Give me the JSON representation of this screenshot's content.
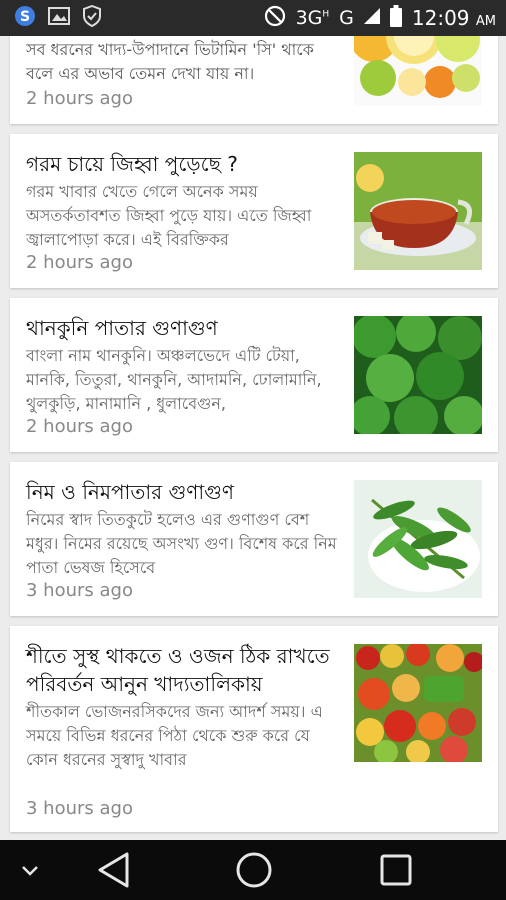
{
  "status_bar": {
    "left_icons": [
      "sync-app-icon",
      "image-icon",
      "shield-check-icon"
    ],
    "network_3g": "3G",
    "network_3g_sup": "H",
    "network_g": "G",
    "time": "12:09",
    "ampm": "AM",
    "right_icons": [
      "do-not-disturb-icon",
      "signal-icon",
      "battery-icon"
    ]
  },
  "articles": [
    {
      "title": "",
      "snippet": "সব ধরনের খাদ্য-উপাদানে ভিটামিন 'সি' থাকে বলে এর অভাব তেমন দেখা যায় না।",
      "time": "2 hours ago",
      "image": "citrus-fruits-thumbnail"
    },
    {
      "title": "গরম চায়ে জিহ্বা পুড়েছে ?",
      "snippet": "গরম খাবার খেতে গেলে অনেক সময় অসতর্কতাবশত জিহ্বা পুড়ে যায়। এতে জিহ্বা জ্বালাপোড়া করে। এই বিরক্তিকর",
      "time": "2 hours ago",
      "image": "tea-cup-thumbnail"
    },
    {
      "title": "থানকুনি পাতার গুণাগুণ",
      "snippet": "বাংলা নাম থানকুনি। অঞ্চলভেদে এটি টেয়া, মানকি, তিতুরা, থানকুনি, আদামনি, ঢোলামানি, থুলকুড়ি, মানামানি , ধুলাবেগুন,",
      "time": "2 hours ago",
      "image": "thankuni-leaves-thumbnail"
    },
    {
      "title": "নিম ও নিমপাতার গুণাগুণ",
      "snippet": "নিমের স্বাদ তিতকুটে হলেও এর গুণাগুণ বেশ মধুর। নিমের রয়েছে অসংখ্য গুণ। বিশেষ করে নিম পাতা ভেষজ হিসেবে",
      "time": "3 hours ago",
      "image": "neem-leaves-thumbnail"
    },
    {
      "title": "শীতে সুস্থ থাকতে ও ওজন ঠিক রাখতে পরিবর্তন আনুন খাদ্যতালিকায়",
      "snippet": "শীতকাল ভোজনরসিকদের জন্য আদর্শ সময়। এ সময়ে বিভিন্ন ধরনের পিঠা থেকে শুরু করে যে কোন ধরনের সুস্বাদু খাবার",
      "time": "3 hours ago",
      "image": "vegetables-fruits-thumbnail"
    }
  ],
  "nav_bar": {
    "buttons": [
      "collapse-chevron-icon",
      "back-icon",
      "home-icon",
      "recents-icon"
    ]
  }
}
